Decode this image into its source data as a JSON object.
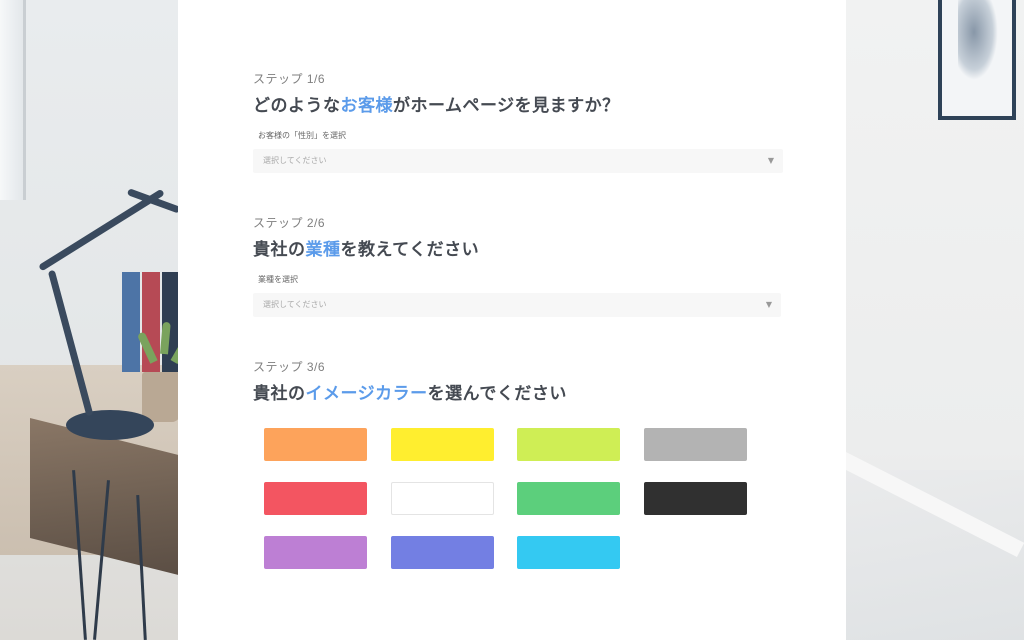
{
  "steps": [
    {
      "label": "ステップ 1/6",
      "title_pre": "どのような",
      "title_hl": "お客様",
      "title_post": "がホームページを見ますか？",
      "field_label": "お客様の「性別」を選択",
      "select_placeholder": "選択してください"
    },
    {
      "label": "ステップ 2/6",
      "title_pre": "貴社の",
      "title_hl": "業種",
      "title_post": "を教えてください",
      "field_label": "業種を選択",
      "select_placeholder": "選択してください"
    },
    {
      "label": "ステップ 3/6",
      "title_pre": "貴社の",
      "title_hl": "イメージカラー",
      "title_post": "を選んでください"
    }
  ],
  "colors": {
    "accent": "#5b9bea",
    "swatches": [
      {
        "name": "orange",
        "color": "#fda35b"
      },
      {
        "name": "yellow",
        "color": "#ffee2f"
      },
      {
        "name": "lime",
        "color": "#cfee55"
      },
      {
        "name": "gray",
        "color": "#b3b3b3"
      },
      {
        "name": "red",
        "color": "#f35561"
      },
      {
        "name": "white",
        "color": "#ffffff"
      },
      {
        "name": "green",
        "color": "#5ccf7c"
      },
      {
        "name": "black",
        "color": "#303030"
      },
      {
        "name": "purple",
        "color": "#bd7fd4"
      },
      {
        "name": "blue-violet",
        "color": "#737fe3"
      },
      {
        "name": "sky-blue",
        "color": "#34c9f2"
      }
    ]
  },
  "icons": {
    "select_caret": "chevron-down-icon"
  }
}
